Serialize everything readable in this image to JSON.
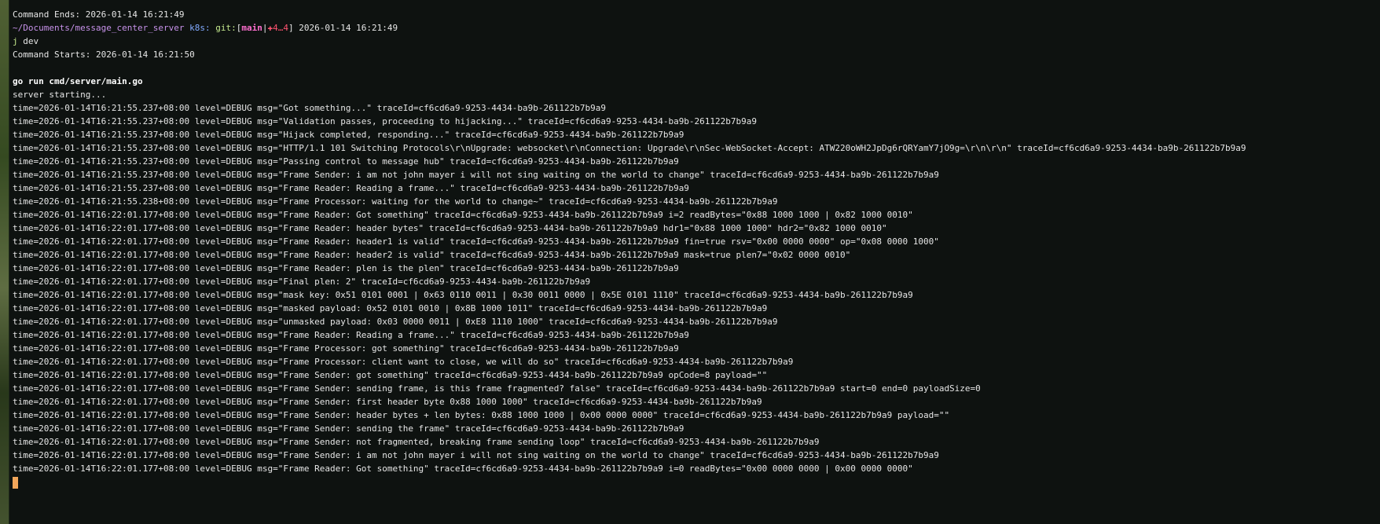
{
  "header": {
    "command_ends": "Command Ends: 2026-01-14 16:21:49",
    "prompt_path": "~/Documents/message_center_server",
    "prompt_k8s": "k8s:",
    "prompt_git": "git:",
    "prompt_branch": "main",
    "prompt_sep": "|",
    "prompt_dirty": "✚4…4",
    "prompt_time": "2026-01-14 16:21:49",
    "command_j": "j",
    "command_rest": " dev",
    "command_starts": "Command Starts: 2026-01-14 16:21:50"
  },
  "run": {
    "go_command": "go run cmd/server/main.go",
    "starting": "server starting..."
  },
  "log_lines": [
    "time=2026-01-14T16:21:55.237+08:00 level=DEBUG msg=\"Got something...\" traceId=cf6cd6a9-9253-4434-ba9b-261122b7b9a9",
    "time=2026-01-14T16:21:55.237+08:00 level=DEBUG msg=\"Validation passes, proceeding to hijacking...\" traceId=cf6cd6a9-9253-4434-ba9b-261122b7b9a9",
    "time=2026-01-14T16:21:55.237+08:00 level=DEBUG msg=\"Hijack completed, responding...\" traceId=cf6cd6a9-9253-4434-ba9b-261122b7b9a9",
    "time=2026-01-14T16:21:55.237+08:00 level=DEBUG msg=\"HTTP/1.1 101 Switching Protocols\\r\\nUpgrade: websocket\\r\\nConnection: Upgrade\\r\\nSec-WebSocket-Accept: ATW220oWH2JpDg6rQRYamY7jO9g=\\r\\n\\r\\n\" traceId=cf6cd6a9-9253-4434-ba9b-261122b7b9a9",
    "time=2026-01-14T16:21:55.237+08:00 level=DEBUG msg=\"Passing control to message hub\" traceId=cf6cd6a9-9253-4434-ba9b-261122b7b9a9",
    "time=2026-01-14T16:21:55.237+08:00 level=DEBUG msg=\"Frame Sender: i am not john mayer i will not sing waiting on the world to change\" traceId=cf6cd6a9-9253-4434-ba9b-261122b7b9a9",
    "time=2026-01-14T16:21:55.237+08:00 level=DEBUG msg=\"Frame Reader: Reading a frame...\" traceId=cf6cd6a9-9253-4434-ba9b-261122b7b9a9",
    "time=2026-01-14T16:21:55.238+08:00 level=DEBUG msg=\"Frame Processor: waiting for the world to change~\" traceId=cf6cd6a9-9253-4434-ba9b-261122b7b9a9",
    "time=2026-01-14T16:22:01.177+08:00 level=DEBUG msg=\"Frame Reader: Got something\" traceId=cf6cd6a9-9253-4434-ba9b-261122b7b9a9 i=2 readBytes=\"0x88 1000 1000 | 0x82 1000 0010\"",
    "time=2026-01-14T16:22:01.177+08:00 level=DEBUG msg=\"Frame Reader: header bytes\" traceId=cf6cd6a9-9253-4434-ba9b-261122b7b9a9 hdr1=\"0x88 1000 1000\" hdr2=\"0x82 1000 0010\"",
    "time=2026-01-14T16:22:01.177+08:00 level=DEBUG msg=\"Frame Reader: header1 is valid\" traceId=cf6cd6a9-9253-4434-ba9b-261122b7b9a9 fin=true rsv=\"0x00 0000 0000\" op=\"0x08 0000 1000\"",
    "time=2026-01-14T16:22:01.177+08:00 level=DEBUG msg=\"Frame Reader: header2 is valid\" traceId=cf6cd6a9-9253-4434-ba9b-261122b7b9a9 mask=true plen7=\"0x02 0000 0010\"",
    "time=2026-01-14T16:22:01.177+08:00 level=DEBUG msg=\"Frame Reader: plen is the plen\" traceId=cf6cd6a9-9253-4434-ba9b-261122b7b9a9",
    "time=2026-01-14T16:22:01.177+08:00 level=DEBUG msg=\"Final plen: 2\" traceId=cf6cd6a9-9253-4434-ba9b-261122b7b9a9",
    "time=2026-01-14T16:22:01.177+08:00 level=DEBUG msg=\"mask key: 0x51 0101 0001 | 0x63 0110 0011 | 0x30 0011 0000 | 0x5E 0101 1110\" traceId=cf6cd6a9-9253-4434-ba9b-261122b7b9a9",
    "time=2026-01-14T16:22:01.177+08:00 level=DEBUG msg=\"masked payload: 0x52 0101 0010 | 0x8B 1000 1011\" traceId=cf6cd6a9-9253-4434-ba9b-261122b7b9a9",
    "time=2026-01-14T16:22:01.177+08:00 level=DEBUG msg=\"unmasked payload: 0x03 0000 0011 | 0xE8 1110 1000\" traceId=cf6cd6a9-9253-4434-ba9b-261122b7b9a9",
    "time=2026-01-14T16:22:01.177+08:00 level=DEBUG msg=\"Frame Reader: Reading a frame...\" traceId=cf6cd6a9-9253-4434-ba9b-261122b7b9a9",
    "time=2026-01-14T16:22:01.177+08:00 level=DEBUG msg=\"Frame Processor: got something\" traceId=cf6cd6a9-9253-4434-ba9b-261122b7b9a9",
    "time=2026-01-14T16:22:01.177+08:00 level=DEBUG msg=\"Frame Processor: client want to close, we will do so\" traceId=cf6cd6a9-9253-4434-ba9b-261122b7b9a9",
    "time=2026-01-14T16:22:01.177+08:00 level=DEBUG msg=\"Frame Sender: got something\" traceId=cf6cd6a9-9253-4434-ba9b-261122b7b9a9 opCode=8 payload=\"\"",
    "time=2026-01-14T16:22:01.177+08:00 level=DEBUG msg=\"Frame Sender: sending frame, is this frame fragmented? false\" traceId=cf6cd6a9-9253-4434-ba9b-261122b7b9a9 start=0 end=0 payloadSize=0",
    "time=2026-01-14T16:22:01.177+08:00 level=DEBUG msg=\"Frame Sender: first header byte 0x88 1000 1000\" traceId=cf6cd6a9-9253-4434-ba9b-261122b7b9a9",
    "time=2026-01-14T16:22:01.177+08:00 level=DEBUG msg=\"Frame Sender: header bytes + len bytes: 0x88 1000 1000 | 0x00 0000 0000\" traceId=cf6cd6a9-9253-4434-ba9b-261122b7b9a9 payload=\"\"",
    "time=2026-01-14T16:22:01.177+08:00 level=DEBUG msg=\"Frame Sender: sending the frame\" traceId=cf6cd6a9-9253-4434-ba9b-261122b7b9a9",
    "time=2026-01-14T16:22:01.177+08:00 level=DEBUG msg=\"Frame Sender: not fragmented, breaking frame sending loop\" traceId=cf6cd6a9-9253-4434-ba9b-261122b7b9a9",
    "time=2026-01-14T16:22:01.177+08:00 level=DEBUG msg=\"Frame Sender: i am not john mayer i will not sing waiting on the world to change\" traceId=cf6cd6a9-9253-4434-ba9b-261122b7b9a9",
    "time=2026-01-14T16:22:01.177+08:00 level=DEBUG msg=\"Frame Reader: Got something\" traceId=cf6cd6a9-9253-4434-ba9b-261122b7b9a9 i=0 readBytes=\"0x00 0000 0000 | 0x00 0000 0000\""
  ],
  "colors": {
    "background": "#0e1210",
    "text": "#e6e6e6",
    "path": "#c792ea",
    "k8s": "#82aaff",
    "git": "#c3e88d",
    "branch": "#ff6fd0",
    "dirty": "#ff5370",
    "cursor": "#f2a65a"
  }
}
